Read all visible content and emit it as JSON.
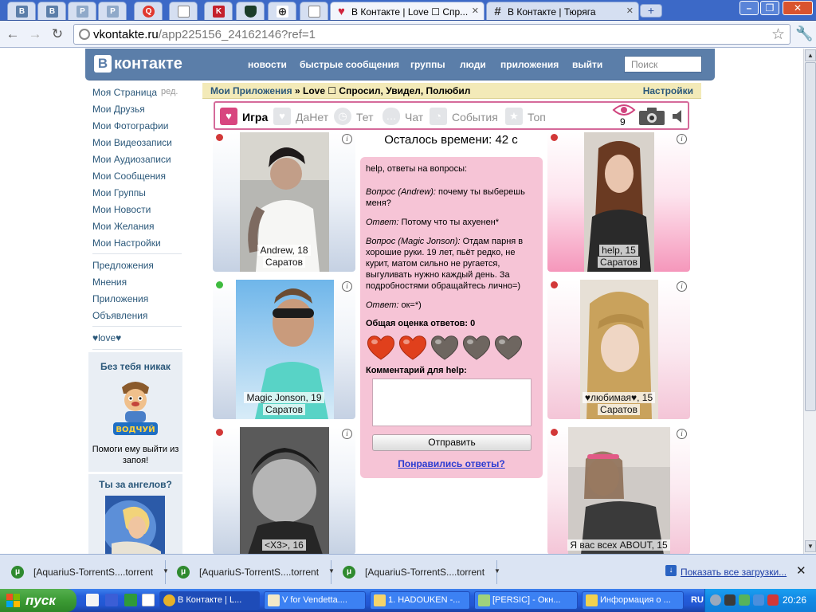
{
  "browser": {
    "tabs": [
      {
        "icon": "vk-icon",
        "glyph": "В",
        "color": "#5b7ea9"
      },
      {
        "icon": "vk-icon",
        "glyph": "В",
        "color": "#5b7ea9"
      },
      {
        "icon": "page-icon",
        "glyph": "P",
        "color": "#8fa9c9"
      },
      {
        "icon": "page-icon",
        "glyph": "P",
        "color": "#8fa9c9"
      },
      {
        "icon": "mail-icon",
        "glyph": "Q",
        "color": "#e0382e"
      },
      {
        "icon": "doc-icon",
        "glyph": "",
        "color": "#e8edf4"
      },
      {
        "icon": "kaspersky-icon",
        "glyph": "K",
        "color": "#c4202b"
      },
      {
        "icon": "shield-icon",
        "glyph": "",
        "color": "#1b3d2a"
      },
      {
        "icon": "target-icon",
        "glyph": "⊕",
        "color": "#6a6a6a"
      },
      {
        "icon": "doc-icon",
        "glyph": "",
        "color": "#e8edf4"
      }
    ],
    "active_tab_title": "В Контакте | Love ☐ Спр...",
    "second_tab_title": "В Контакте | Тюряга",
    "url_host": "vkontakte.ru",
    "url_path": "/app225156_24162146?ref=1"
  },
  "vk": {
    "logo_letter": "В",
    "logo_text": "контакте",
    "nav": [
      "новости",
      "быстрые сообщения",
      "группы",
      "люди",
      "приложения",
      "выйти"
    ],
    "search_placeholder": "Поиск",
    "menu": [
      "Моя Страница",
      "Мои Друзья",
      "Мои Фотографии",
      "Мои Видеозаписи",
      "Мои Аудиозаписи",
      "Мои Сообщения",
      "Мои Группы",
      "Мои Новости",
      "Мои Желания",
      "Мои Настройки"
    ],
    "menu_edit": "ред.",
    "menu2": [
      "Предложения",
      "Мнения",
      "Приложения",
      "Объявления"
    ],
    "menu3": "♥love♥",
    "promo1_title": "Без тебя никак",
    "promo1_text": "Помоги ему выйти из запоя!",
    "promo1_logo": "ВОДЧУЙ",
    "promo2_title": "Ты за ангелов?"
  },
  "app": {
    "breadcrumb_link": "Мои Приложения",
    "breadcrumb_sep": " » ",
    "breadcrumb_title": "Love ☐ Спросил, Увидел, Полюбил",
    "settings": "Настройки",
    "nav": [
      {
        "label": "Игра",
        "icon": "heart-icon",
        "active": true
      },
      {
        "label": "ДаНет",
        "icon": "heart-icon",
        "active": false
      },
      {
        "label": "Тет",
        "icon": "clock-icon",
        "active": false
      },
      {
        "label": "Чат",
        "icon": "chat-icon",
        "active": false
      },
      {
        "label": "События",
        "icon": "rss-icon",
        "active": false
      },
      {
        "label": "Топ",
        "icon": "star-icon",
        "active": false
      }
    ],
    "views_count": "9",
    "timer": "Осталось времени: 42 с",
    "cards_left": [
      {
        "name": "Andrew, 18",
        "city": "Саратов",
        "status": "offline"
      },
      {
        "name": "Magic Jonson, 19",
        "city": "Саратов",
        "status": "online"
      },
      {
        "name": "<X3>, 16",
        "city": "",
        "status": "offline"
      }
    ],
    "cards_right": [
      {
        "name": "help, 15",
        "city": "Саратов",
        "status": "offline"
      },
      {
        "name": "♥любимая♥, 15",
        "city": "Саратов",
        "status": "offline"
      },
      {
        "name": "Я вас всех ABOUT, 15",
        "city": "",
        "status": "offline"
      }
    ],
    "qa_header": "help, ответы на вопросы:",
    "q1_label": "Вопрос (Andrew):",
    "q1_text": "почему ты выберешь меня?",
    "a1_label": "Ответ:",
    "a1_text": "Потому что ты ахуенен*",
    "q2_label": "Вопрос (Magic Jonson):",
    "q2_text": "Отдам парня в хорошие руки. 19 лет, пьёт редко, не курит, матом сильно не ругается, выгуливать нужно каждый день. За подробностями обращайтесь лично=)",
    "a2_label": "Ответ:",
    "a2_text": "ок=*)",
    "score_label": "Общая оценка ответов: 0",
    "rating": {
      "filled": 2,
      "max": 5
    },
    "comment_label": "Комментарий для help:",
    "send_label": "Отправить",
    "like_link": "Понравились ответы?"
  },
  "downloads": {
    "items": [
      "[AquariuS-TorrentS....torrent",
      "[AquariuS-TorrentS....torrent",
      "[AquariuS-TorrentS....torrent"
    ],
    "show_all": "Показать все загрузки..."
  },
  "taskbar": {
    "start_label": "пуск",
    "tasks": [
      "В Контакте | L...",
      "V for Vendetta....",
      "1. HADOUKEN -...",
      "[PERSIC] - Окн...",
      "Информация о ..."
    ],
    "lang": "RU",
    "clock": "20:26"
  }
}
